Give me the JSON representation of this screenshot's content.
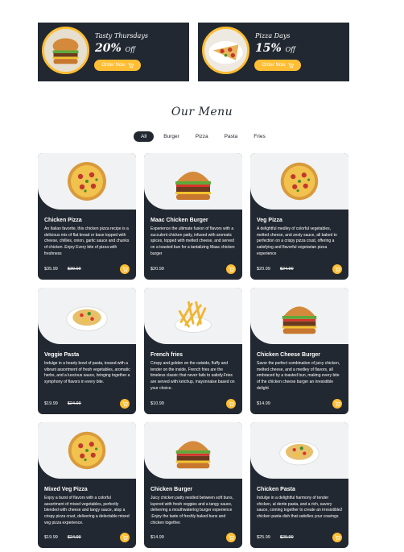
{
  "offers": [
    {
      "title": "Tasty Thursdays",
      "percent": "20%",
      "off": "Off",
      "button": "Order Now",
      "image_icon": "burger-icon"
    },
    {
      "title": "Pizza Days",
      "percent": "15%",
      "off": "Off",
      "button": "Order Now",
      "image_icon": "pizza-slice-icon"
    }
  ],
  "menu": {
    "heading": "Our Menu",
    "filters": [
      "All",
      "Burger",
      "Pizza",
      "Pasta",
      "Fries"
    ],
    "active_filter": "All"
  },
  "items": [
    {
      "name": "Chicken Pizza",
      "description": "An Italian favorite, this chicken pizza recipe is a delicious mix of flat bread or base topped with cheese, chillies, onion, garlic sauce and chunks of chicken .Enjoy Every bite of pizza with freshness",
      "price": "$35.99",
      "old_price": "$39.99",
      "icon": "pizza-icon"
    },
    {
      "name": "Maac Chicken Burger",
      "description": "Experience the ultimate fusion of flavors with a succulent chicken patty, infused with aromatic spices, topped with melted cheese, and served on a toasted bun for a tantalizing Maac chicken burger",
      "price": "$20.99",
      "old_price": "",
      "icon": "burger-icon"
    },
    {
      "name": "Veg Pizza",
      "description": "A delightful medley of colorful vegetables, melted cheese, and zesty sauce, all baked to perfection on a crispy pizza crust, offering a satisfying and flavorful vegetarian pizza experience",
      "price": "$20.99",
      "old_price": "$24.99",
      "icon": "pizza-icon"
    },
    {
      "name": "Veggie Pasta",
      "description": "Indulge in a hearty bowl of pasta, tossed with a vibrant assortment of fresh vegetables, aromatic herbs, and a luscious sauce, bringing together a symphony of flavors in every bite.",
      "price": "$19.99",
      "old_price": "$24.99",
      "icon": "pasta-icon"
    },
    {
      "name": "French fries",
      "description": "Crispy and golden on the outside, fluffy and tender on the inside, French fries are the timeless classic that never fails to satisfy.Fries are served with ketchup, mayonnaise based on your choice.",
      "price": "$10.99",
      "old_price": "",
      "icon": "fries-icon"
    },
    {
      "name": "Chicken Cheese Burger",
      "description": "Savor the perfect combination of juicy chicken, melted cheese, and a medley of flavors, all embraced by a toasted bun, making every bite of the chicken cheese burger an irresistible delight",
      "price": "$14.99",
      "old_price": "",
      "icon": "burger-icon"
    },
    {
      "name": "Mixed Veg Pizza",
      "description": "Enjoy a burst of flavors with a colorful assortment of mixed vegetables, perfectly blended with cheese and tangy sauce, atop a crispy pizza crust, delivering a delectable mixed veg pizza experience.",
      "price": "$19.99",
      "old_price": "$24.99",
      "icon": "pizza-icon"
    },
    {
      "name": "Chicken Burger",
      "description": "Juicy chicken patty nestled between soft buns, layered with fresh veggies and a tangy sauce, delivering a mouthwatering burger experience .Enjoy the taste of freshly baked buns and chicken together.",
      "price": "$14.99",
      "old_price": "",
      "icon": "burger-icon"
    },
    {
      "name": "Chicken Pasta",
      "description": "Indulge in a delightful harmony of tender chicken, al dente pasta, and a rich, savory sauce, coming together to create an irresistible2 chicken pasta dish that satisfies your cravings",
      "price": "$25.99",
      "old_price": "$29.99",
      "icon": "pasta-icon"
    }
  ],
  "colors": {
    "dark": "#222831",
    "accent": "#ffbe33",
    "image_bg": "#f1f2f3"
  }
}
